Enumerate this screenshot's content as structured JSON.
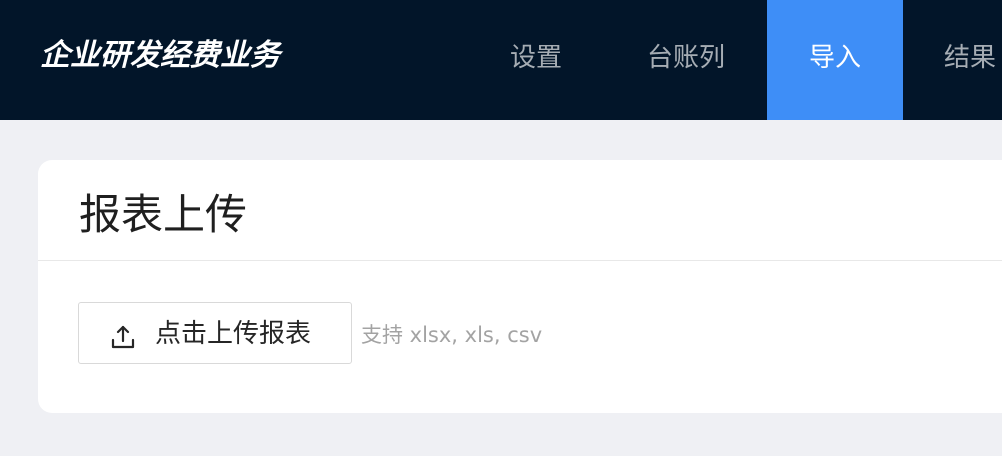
{
  "header": {
    "title": "企业研发经费业务",
    "nav": [
      {
        "label": "设置",
        "active": false
      },
      {
        "label": "台账列",
        "active": false
      },
      {
        "label": "导入",
        "active": true
      },
      {
        "label": "结果",
        "active": false
      }
    ]
  },
  "card": {
    "title": "报表上传",
    "upload_button": {
      "label": "点击上传报表",
      "icon": "upload-icon"
    },
    "hint": "支持 xlsx, xls, csv"
  },
  "colors": {
    "header_bg": "#021529",
    "accent": "#3e8ef7",
    "page_bg": "#eff0f4"
  }
}
